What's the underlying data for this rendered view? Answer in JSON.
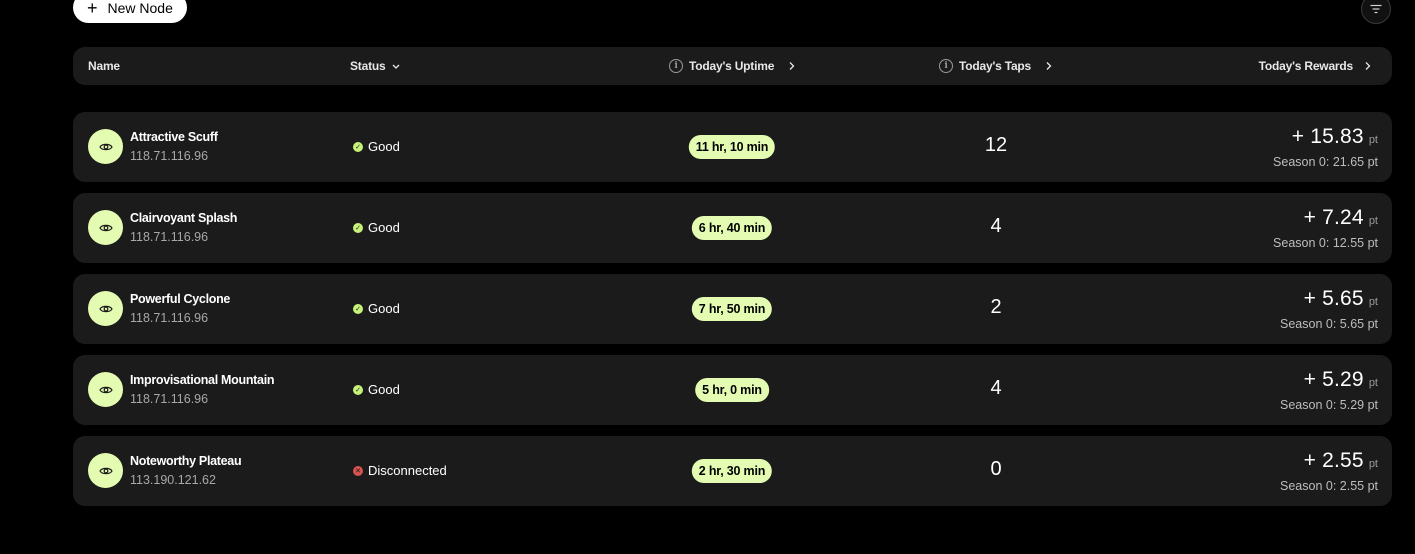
{
  "toolbar": {
    "new_node_label": "New Node",
    "new_node_icon": "plus-icon",
    "filter_icon": "filter-icon"
  },
  "table": {
    "headers": {
      "name": "Name",
      "status": "Status",
      "uptime": "Today's Uptime",
      "taps": "Today's Taps",
      "rewards": "Today's Rewards"
    },
    "rows": [
      {
        "name": "Attractive Scuff",
        "ip": "118.71.116.96",
        "status": "Good",
        "status_type": "good",
        "uptime": "11 hr, 10 min",
        "taps": "12",
        "reward": "+ 15.83",
        "unit": "pt",
        "season": "Season 0: 21.65 pt"
      },
      {
        "name": "Clairvoyant Splash",
        "ip": "118.71.116.96",
        "status": "Good",
        "status_type": "good",
        "uptime": "6 hr, 40 min",
        "taps": "4",
        "reward": "+ 7.24",
        "unit": "pt",
        "season": "Season 0: 12.55 pt"
      },
      {
        "name": "Powerful Cyclone",
        "ip": "118.71.116.96",
        "status": "Good",
        "status_type": "good",
        "uptime": "7 hr, 50 min",
        "taps": "2",
        "reward": "+ 5.65",
        "unit": "pt",
        "season": "Season 0: 5.65 pt"
      },
      {
        "name": "Improvisational Mountain",
        "ip": "118.71.116.96",
        "status": "Good",
        "status_type": "good",
        "uptime": "5 hr, 0 min",
        "taps": "4",
        "reward": "+ 5.29",
        "unit": "pt",
        "season": "Season 0: 5.29 pt"
      },
      {
        "name": "Noteworthy Plateau",
        "ip": "113.190.121.62",
        "status": "Disconnected",
        "status_type": "disconnected",
        "uptime": "2 hr, 30 min",
        "taps": "0",
        "reward": "+ 2.55",
        "unit": "pt",
        "season": "Season 0: 2.55 pt"
      }
    ]
  },
  "colors": {
    "accent": "#e4fcb2",
    "good": "#c6f27a",
    "disconnected": "#d9534f",
    "row_bg": "#1b1b1b"
  }
}
